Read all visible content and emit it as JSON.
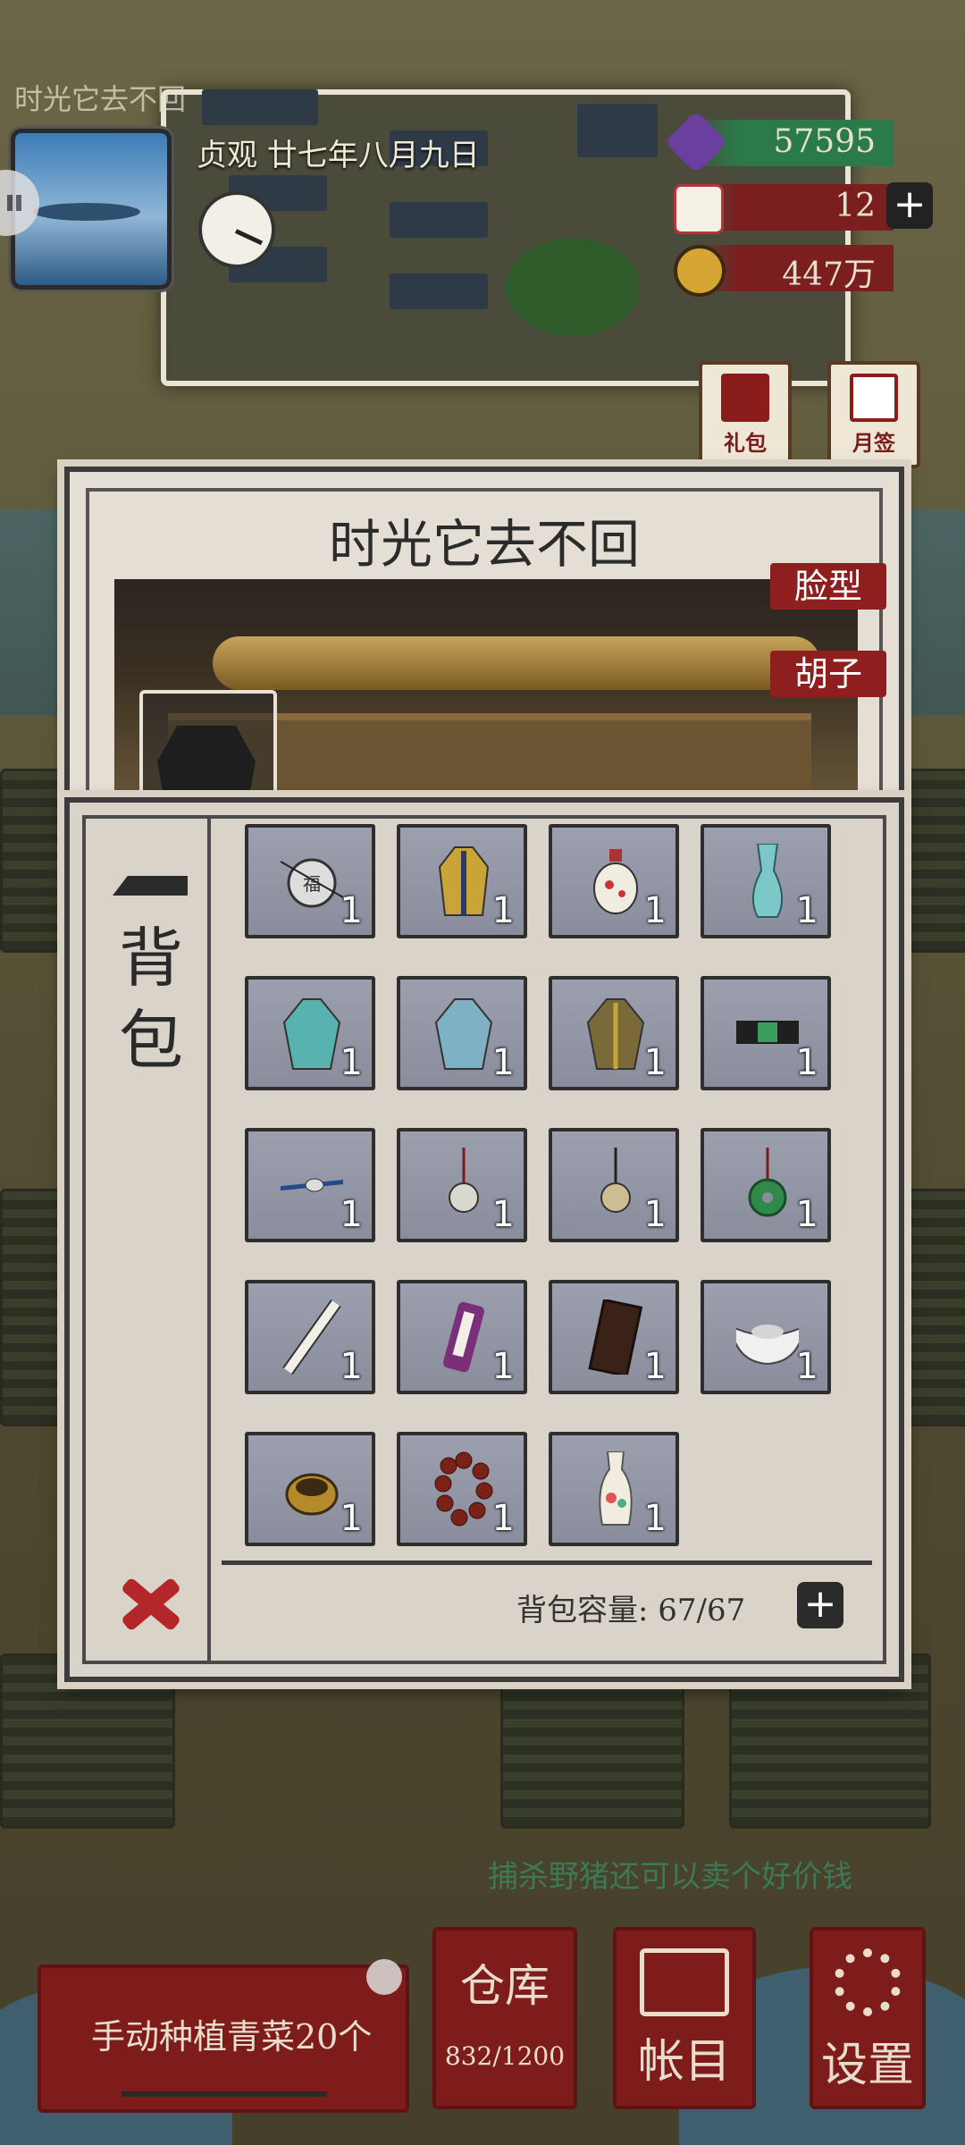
{
  "hud": {
    "player_name": "时光它去不回",
    "date": "贞观 廿七年八月九日",
    "resources": [
      {
        "icon": "jade-gem-icon",
        "value": "57595"
      },
      {
        "icon": "silver-ingot-icon",
        "value": "12"
      },
      {
        "icon": "copper-coin-icon",
        "value": "447万"
      }
    ],
    "gift_label": "礼包",
    "monthly_sign_label": "月签"
  },
  "character_dialog": {
    "title": "时光它去不回",
    "tabs": [
      "脸型",
      "胡子"
    ]
  },
  "bag": {
    "label": "背包",
    "capacity_label": "背包容量",
    "capacity": "67/67",
    "items": [
      {
        "name": "fu-pendant",
        "qty": "1"
      },
      {
        "name": "yellow-robe",
        "qty": "1"
      },
      {
        "name": "snuff-bottle",
        "qty": "1"
      },
      {
        "name": "celadon-vase",
        "qty": "1"
      },
      {
        "name": "teal-robe",
        "qty": "1"
      },
      {
        "name": "light-blue-robe",
        "qty": "1"
      },
      {
        "name": "brown-robe",
        "qty": "1"
      },
      {
        "name": "jade-belt",
        "qty": "1"
      },
      {
        "name": "hairpin",
        "qty": "1"
      },
      {
        "name": "silver-charm-pendant",
        "qty": "1"
      },
      {
        "name": "bronze-charm-pendant",
        "qty": "1"
      },
      {
        "name": "jade-bi-pendant",
        "qty": "1"
      },
      {
        "name": "paper-scroll",
        "qty": "1"
      },
      {
        "name": "purple-scroll",
        "qty": "1"
      },
      {
        "name": "abacus",
        "qty": "1"
      },
      {
        "name": "silver-ingot",
        "qty": "1"
      },
      {
        "name": "gold-ring",
        "qty": "1"
      },
      {
        "name": "prayer-beads",
        "qty": "1"
      },
      {
        "name": "porcelain-vase",
        "qty": "1"
      }
    ]
  },
  "bottom": {
    "tip": "捕杀野猪还可以卖个好价钱",
    "task": "手动种植青菜20个",
    "warehouse_label": "仓库",
    "warehouse_capacity": "832/1200",
    "ledger_label": "帐目",
    "settings_label": "设置"
  }
}
